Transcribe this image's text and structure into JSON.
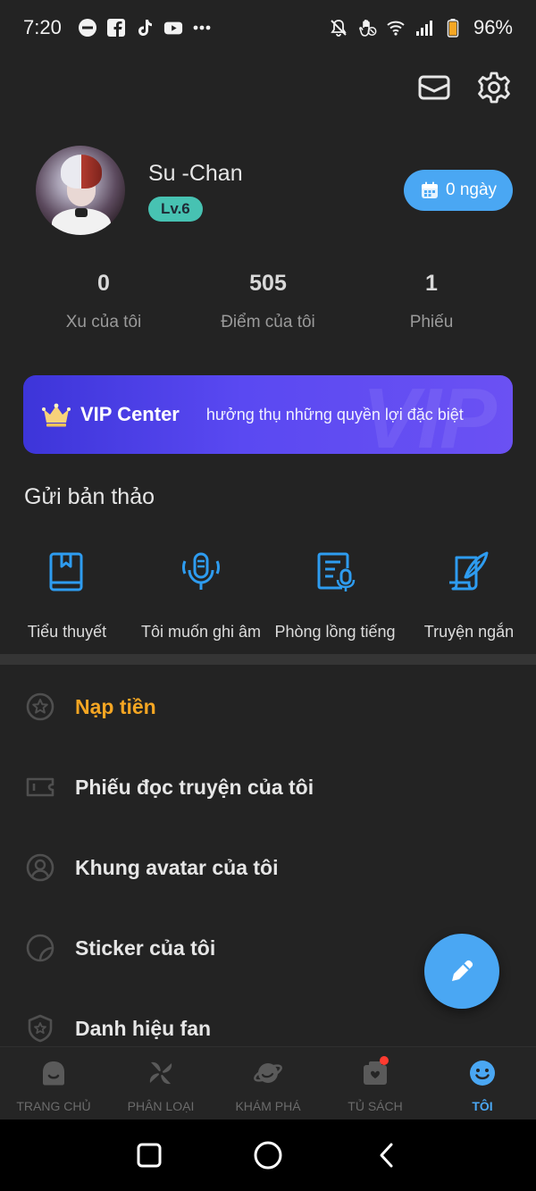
{
  "status_bar": {
    "time": "7:20",
    "battery": "96%",
    "left_icons": [
      "minus-circle-icon",
      "facebook-icon",
      "tiktok-icon",
      "youtube-icon",
      "more-dots-icon"
    ],
    "right_icons": [
      "bell-off-icon",
      "hand-icon",
      "wifi-icon",
      "signal-icon",
      "battery-icon"
    ]
  },
  "header": {
    "icons": [
      "mail-icon",
      "gear-icon"
    ]
  },
  "profile": {
    "name": "Su -Chan",
    "level": "Lv.6",
    "checkin_label": "0 ngày"
  },
  "stats": [
    {
      "value": "0",
      "label": "Xu của tôi"
    },
    {
      "value": "505",
      "label": "Điểm của tôi"
    },
    {
      "value": "1",
      "label": "Phiếu"
    }
  ],
  "vip": {
    "title": "VIP Center",
    "description": "hưởng thụ những quyền lợi đặc biệt",
    "watermark": "VIP"
  },
  "submit_section": {
    "title": "Gửi bản thảo",
    "items": [
      {
        "label": "Tiểu thuyết",
        "icon": "book-icon"
      },
      {
        "label": "Tôi muốn ghi âm",
        "icon": "microphone-icon"
      },
      {
        "label": "Phòng lồng tiếng",
        "icon": "dubbing-document-icon"
      },
      {
        "label": "Truyện ngắn",
        "icon": "quill-paper-icon"
      }
    ]
  },
  "menu": [
    {
      "label": "Nạp tiền",
      "icon": "star-circle-icon",
      "accent": true
    },
    {
      "label": "Phiếu đọc truyện của tôi",
      "icon": "ticket-icon"
    },
    {
      "label": "Khung avatar của tôi",
      "icon": "avatar-frame-icon"
    },
    {
      "label": "Sticker của tôi",
      "icon": "sticker-icon"
    },
    {
      "label": "Danh hiệu fan",
      "icon": "shield-star-icon"
    }
  ],
  "bottom_nav": [
    {
      "label": "TRANG CHỦ",
      "icon": "home-icon",
      "active": false
    },
    {
      "label": "PHÂN LOẠI",
      "icon": "pinwheel-icon",
      "active": false
    },
    {
      "label": "KHÁM PHÁ",
      "icon": "planet-icon",
      "active": false
    },
    {
      "label": "TỦ SÁCH",
      "icon": "bookshelf-icon",
      "active": false,
      "badge": true
    },
    {
      "label": "TÔI",
      "icon": "smiley-icon",
      "active": true
    }
  ],
  "colors": {
    "background": "#232323",
    "accent_blue": "#4aa7f3",
    "accent_orange": "#f5a623",
    "level_badge": "#47c2b2",
    "vip_gradient_start": "#3d35d9",
    "vip_gradient_end": "#6b51f3"
  }
}
